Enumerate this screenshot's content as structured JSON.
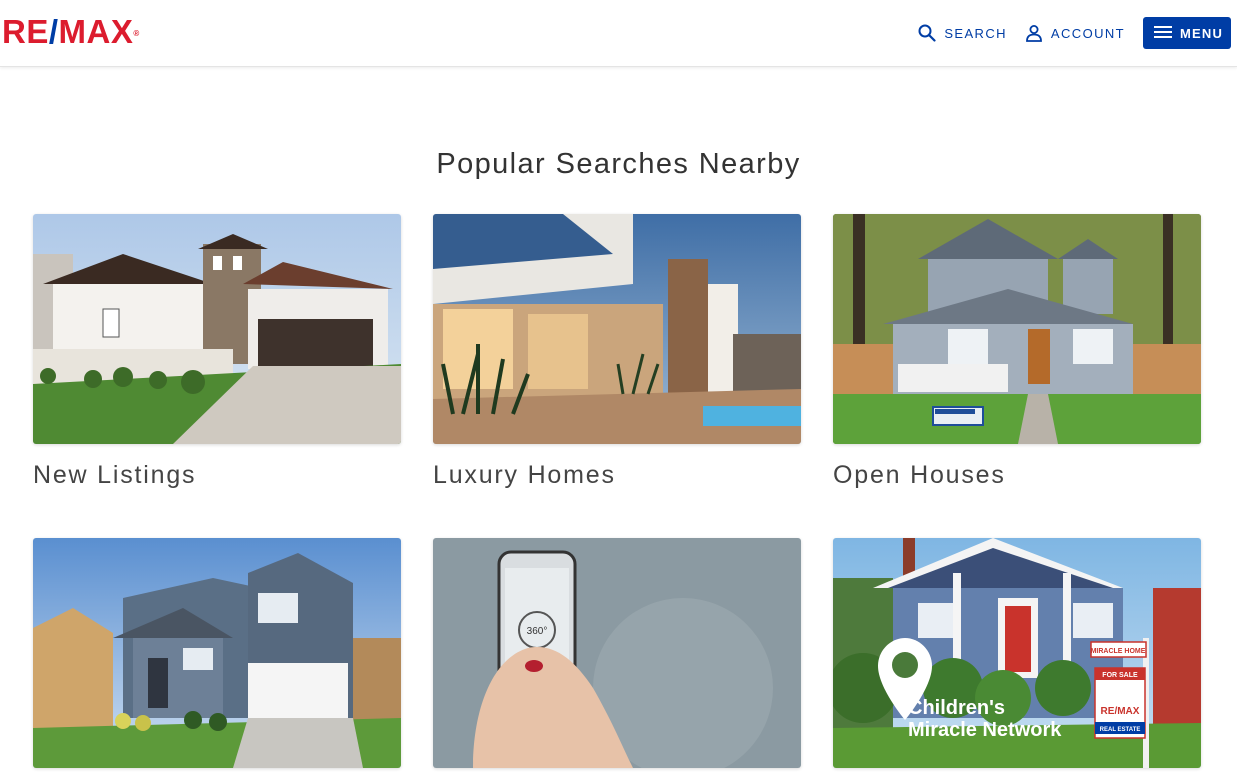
{
  "brand": {
    "logo_text_1": "RE",
    "logo_slash": "/",
    "logo_text_2": "MAX",
    "logo_reg": "®",
    "primary_red": "#dc1c2e",
    "primary_blue": "#003da5"
  },
  "nav": {
    "search_label": "SEARCH",
    "account_label": "ACCOUNT",
    "menu_label": "MENU"
  },
  "section": {
    "title": "Popular Searches Nearby"
  },
  "cards": [
    {
      "label": "New Listings",
      "image": "spanish-style-house-photo"
    },
    {
      "label": "Luxury Homes",
      "image": "modern-luxury-house-photo"
    },
    {
      "label": "Open Houses",
      "image": "craftsman-house-open-house-sign-photo"
    },
    {
      "label": "",
      "image": "two-story-blue-house-photo"
    },
    {
      "label": "",
      "image": "hand-holding-phone-360-tour-photo"
    },
    {
      "label": "",
      "image": "childrens-miracle-network-house-photo"
    }
  ],
  "card_overlays": {
    "cmn_line1": "Children's",
    "cmn_line2": "Miracle Network",
    "open_house_sign": "OPEN HOUSE",
    "miracle_home": "MIRACLE HOME",
    "for_sale": "FOR SALE",
    "sign_brand": "RE/MAX",
    "real_estate": "REAL ESTATE",
    "tour_360": "360°"
  }
}
